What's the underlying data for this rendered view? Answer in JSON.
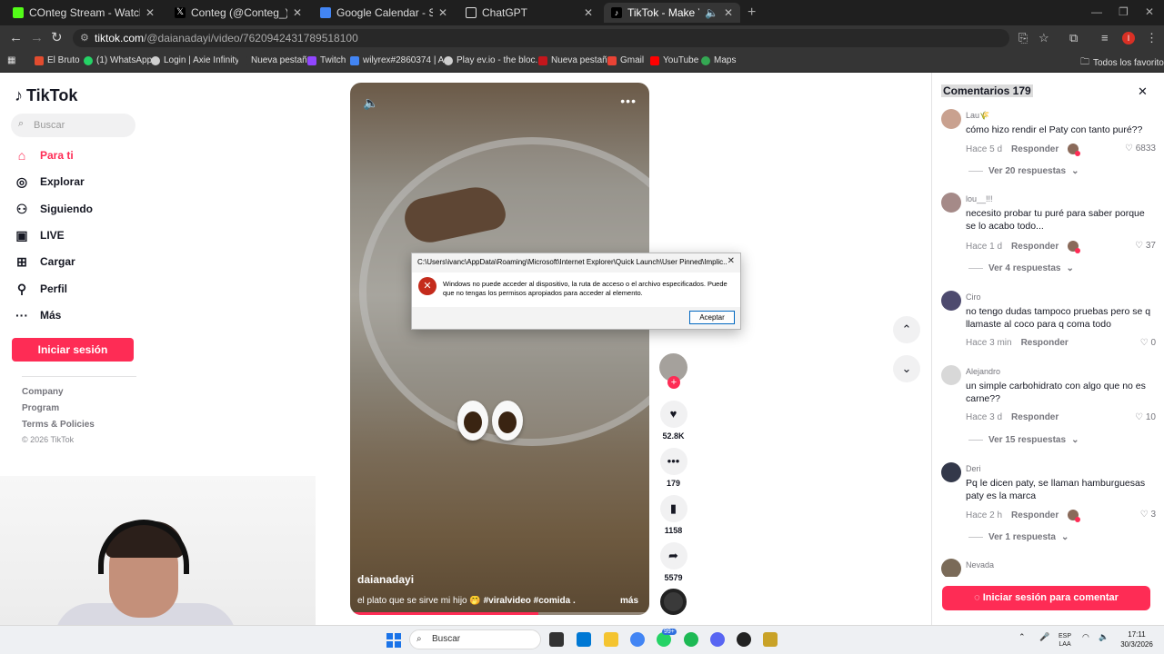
{
  "browser": {
    "tabs": [
      {
        "label": "COnteg Stream - Watch Live on",
        "color": "#53fc18"
      },
      {
        "label": "Conteg (@Conteg_) / X",
        "color": "#000000"
      },
      {
        "label": "Google Calendar - Semana del",
        "color": "#4285f4"
      },
      {
        "label": "ChatGPT",
        "color": "#ffffff"
      },
      {
        "label": "TikTok - Make Your Day",
        "color": "#000000"
      }
    ],
    "url_host": "tiktok.com",
    "url_path": "/@daianadayi/video/7620942431789518100",
    "profile_initial": "I",
    "bookmarks": [
      {
        "label": "El Bruto",
        "color": "#e24c2f"
      },
      {
        "label": "(1) WhatsApp",
        "color": "#25d366"
      },
      {
        "label": "Login | Axie Infinity",
        "color": "#cfcfcf"
      },
      {
        "label": "Nueva pestaña",
        "color": "#353535"
      },
      {
        "label": "Twitch",
        "color": "#9146ff"
      },
      {
        "label": "wilyrex#2860374 | A...",
        "color": "#4285f4"
      },
      {
        "label": "Play ev.io - the bloc...",
        "color": "#cfcfcf"
      },
      {
        "label": "Nueva pestaña",
        "color": "#c4161c"
      },
      {
        "label": "Gmail",
        "color": "#ea4335"
      },
      {
        "label": "YouTube",
        "color": "#ff0000"
      },
      {
        "label": "Maps",
        "color": "#34a853"
      }
    ],
    "all_favorites": "Todos los favoritos"
  },
  "sidebar": {
    "logo": "TikTok",
    "search_placeholder": "Buscar",
    "nav": [
      {
        "label": "Para ti",
        "icon": "home-icon"
      },
      {
        "label": "Explorar",
        "icon": "compass-icon"
      },
      {
        "label": "Siguiendo",
        "icon": "following-icon"
      },
      {
        "label": "LIVE",
        "icon": "live-icon"
      },
      {
        "label": "Cargar",
        "icon": "upload-icon"
      },
      {
        "label": "Perfil",
        "icon": "profile-icon"
      },
      {
        "label": "Más",
        "icon": "more-icon"
      }
    ],
    "login_button": "Iniciar sesión",
    "footer": [
      "Company",
      "Program",
      "Terms & Policies"
    ],
    "copyright": "© 2026 TikTok"
  },
  "video": {
    "author": "daianadayi",
    "caption_text": "el plato que se sirve mi hijo 🤭 ",
    "caption_tags": "#viralvideo #comida ...",
    "more": "más",
    "progress": 0.63,
    "likes": "52.8K",
    "comments": "179",
    "saves": "1158",
    "shares": "5579"
  },
  "dialog": {
    "title": "C:\\Users\\ivanc\\AppData\\Roaming\\Microsoft\\Internet Explorer\\Quick Launch\\User Pinned\\Implic...",
    "message": "Windows no puede acceder al dispositivo, la ruta de acceso o el archivo especificados. Puede que no tengas los permisos apropiados para acceder al elemento.",
    "ok": "Aceptar"
  },
  "comments": {
    "title": "Comentarios 179",
    "login_button": "Iniciar sesión para comentar",
    "reply_label": "Responder",
    "items": [
      {
        "user": "Lau🌾",
        "text": "cómo hizo rendir el Paty con tanto puré??",
        "time": "Hace 5 d",
        "likes": "6833",
        "replies": "Ver 20 respuestas"
      },
      {
        "user": "lou__!!!",
        "text": "necesito probar tu puré para saber porque se lo acabo todo...",
        "time": "Hace 1 d",
        "likes": "37",
        "replies": "Ver 4 respuestas"
      },
      {
        "user": "Ciro",
        "text": "no tengo dudas tampoco pruebas pero se q llamaste al coco para q coma todo",
        "time": "Hace 3 min",
        "likes": "0",
        "replies": ""
      },
      {
        "user": "Alejandro",
        "text": "un simple carbohidrato con algo que no es carne??",
        "time": "Hace 3 d",
        "likes": "10",
        "replies": "Ver 15 respuestas"
      },
      {
        "user": "Deri",
        "text": "Pq le dicen paty, se llaman hamburguesas paty es la marca",
        "time": "Hace 2 h",
        "likes": "3",
        "replies": "Ver 1 respuesta"
      },
      {
        "user": "Nevada",
        "text": "",
        "time": "",
        "likes": "",
        "replies": ""
      }
    ]
  },
  "taskbar": {
    "search": "Buscar",
    "badge": "99+",
    "lang": "ESP",
    "region": "LAA",
    "time": "17:11",
    "date": "30/3/2026"
  }
}
